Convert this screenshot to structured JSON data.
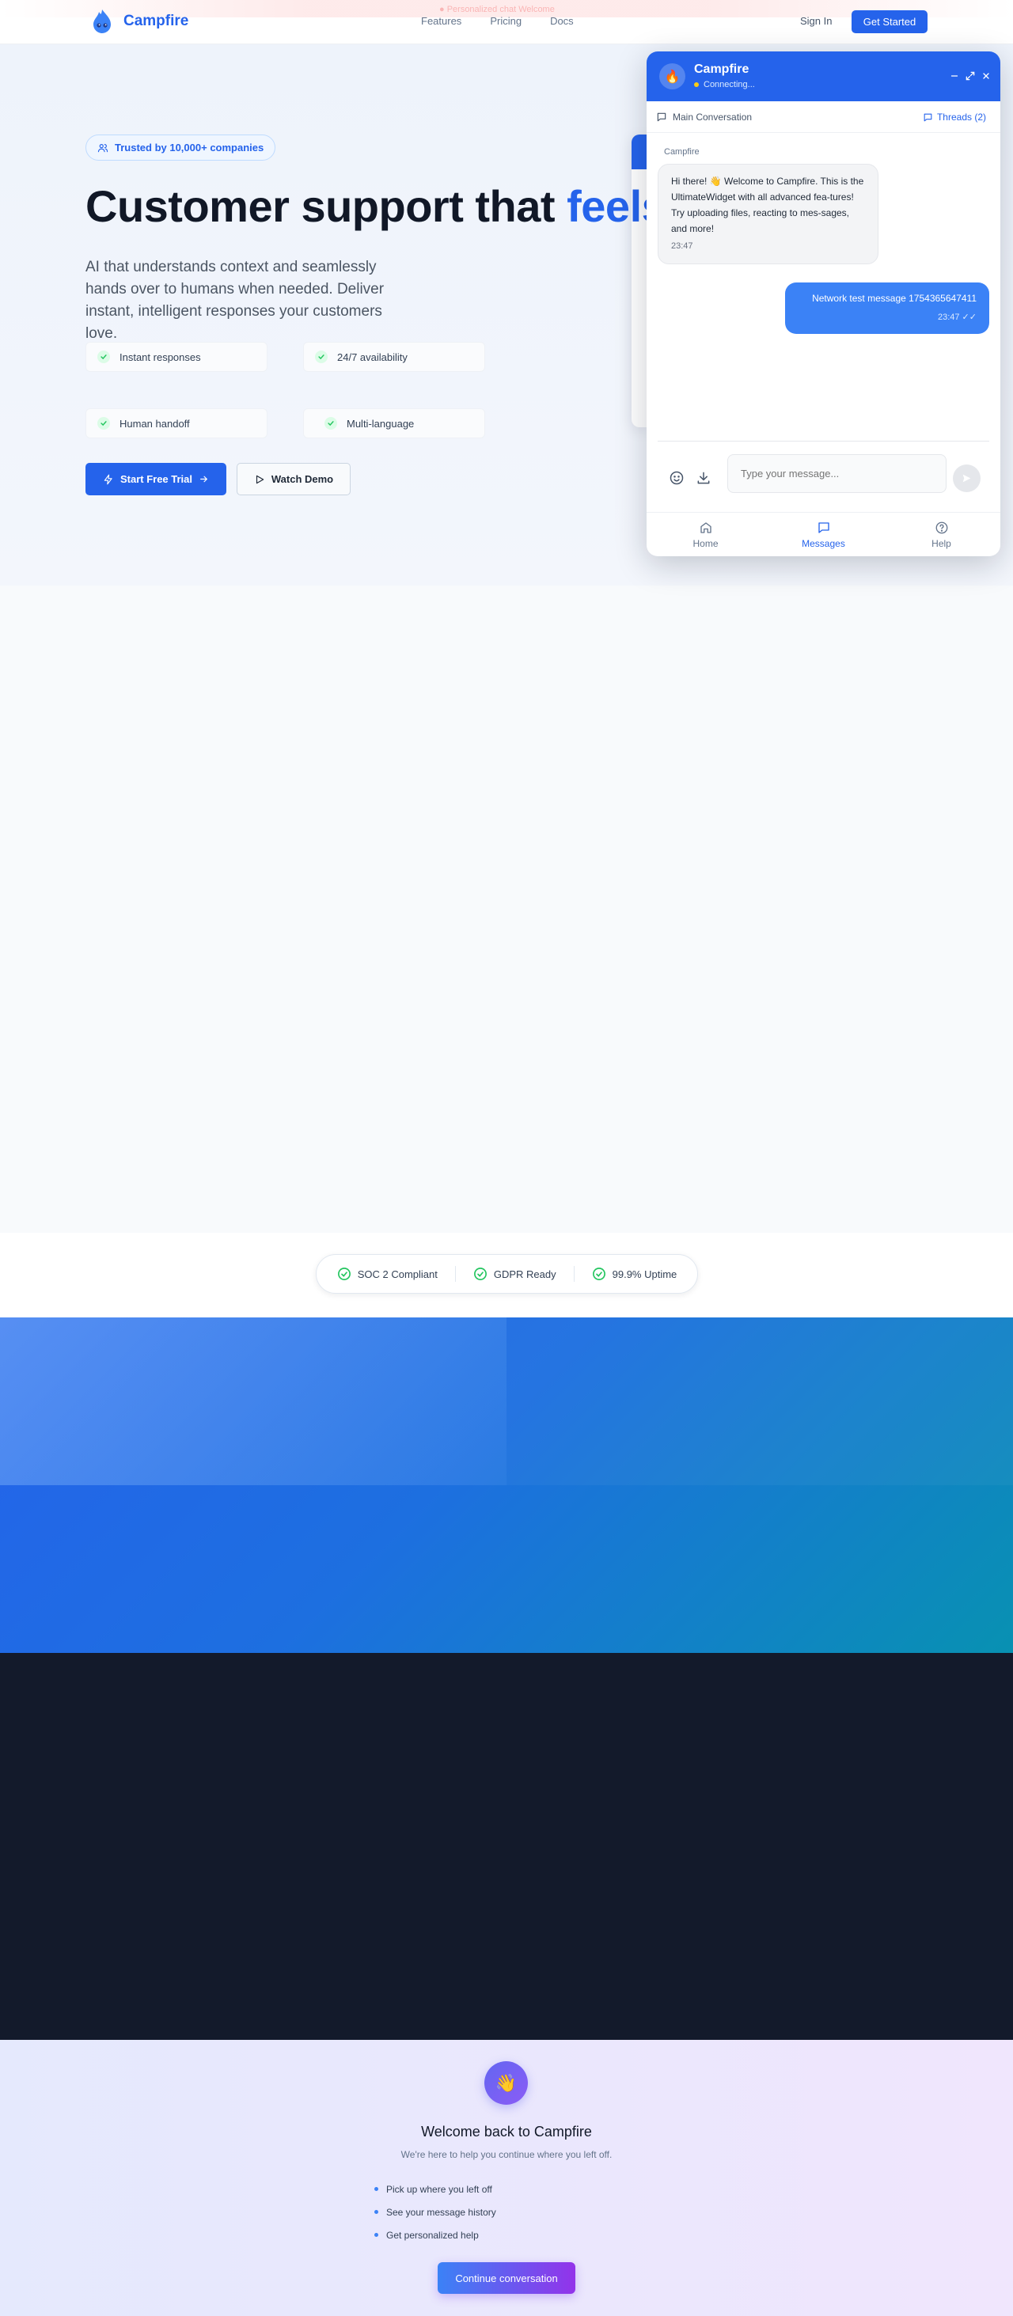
{
  "banner": {
    "text": "● Personalized chat Welcome"
  },
  "header": {
    "brand": "Campfire",
    "nav": [
      "Features",
      "Pricing",
      "Docs"
    ],
    "sign_in": "Sign In",
    "get_started": "Get Started"
  },
  "hero": {
    "trusted_badge": "Trusted by 10,000+ companies",
    "title_main": "Customer support that ",
    "title_accent": "feels",
    "subtitle": "AI that understands context and seamlessly hands over to humans when needed. Deliver instant, intelligent responses your customers love.",
    "features": [
      "Instant responses",
      "24/7 availability",
      "Human handoff",
      "Multi-language"
    ],
    "primary_button": "Start Free Trial",
    "secondary_button": "Watch Demo"
  },
  "compliance": {
    "items": [
      "SOC 2 Compliant",
      "GDPR Ready",
      "99.9% Uptime"
    ]
  },
  "welcome_back": {
    "emoji": "👋",
    "title": "Welcome back to Campfire",
    "subtitle": "We're here to help you continue where you left off.",
    "items": [
      "Pick up where you left off",
      "See your message history",
      "Get personalized help"
    ],
    "button": "Continue conversation"
  },
  "widget": {
    "avatar_emoji": "🔥",
    "name": "Campfire",
    "status": "Connecting...",
    "main_conversation": "Main Conversation",
    "threads": "Threads (2)",
    "sender": "Campfire",
    "incoming_message": "Hi there! 👋 Welcome to Campfire. This is the UltimateWidget with all advanced fea-tures! Try uploading files, reacting to mes-sages, and more!",
    "incoming_time": "23:47",
    "outgoing_message": "Network test message 1754365647411",
    "outgoing_time": "23:47 ✓✓",
    "input_placeholder": "Type your message...",
    "nav": [
      "Home",
      "Messages",
      "Help"
    ],
    "active_nav": "Messages"
  },
  "colors": {
    "brand": "#2563eb",
    "success": "#22c55e",
    "dark_section": "#131a2b"
  }
}
